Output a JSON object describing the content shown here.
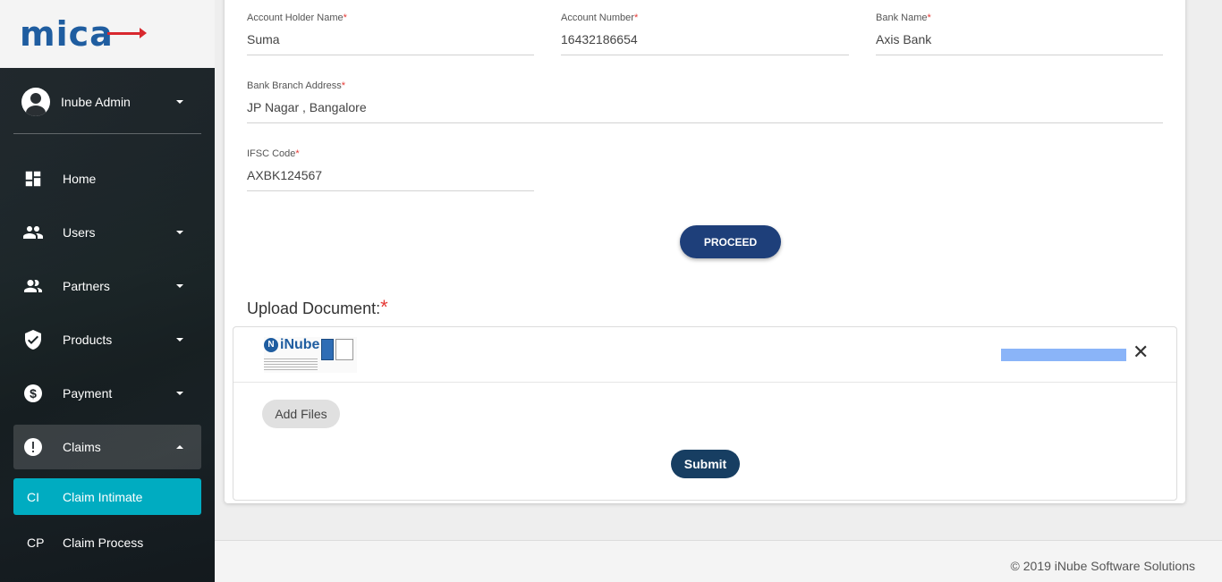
{
  "app": {
    "logo_text": "mica"
  },
  "user": {
    "name": "Inube Admin"
  },
  "sidebar": {
    "items": [
      {
        "label": "Home",
        "icon": "dashboard-icon"
      },
      {
        "label": "Users",
        "icon": "users-icon"
      },
      {
        "label": "Partners",
        "icon": "partners-icon"
      },
      {
        "label": "Products",
        "icon": "shield-check-icon"
      },
      {
        "label": "Payment",
        "icon": "dollar-icon"
      },
      {
        "label": "Claims",
        "icon": "alert-icon"
      }
    ],
    "sub_items": [
      {
        "abbr": "CI",
        "label": "Claim Intimate"
      },
      {
        "abbr": "CP",
        "label": "Claim Process"
      }
    ]
  },
  "form": {
    "account_holder": {
      "label": "Account Holder Name",
      "value": "Suma"
    },
    "account_number": {
      "label": "Account Number",
      "value": "16432186654"
    },
    "bank_name": {
      "label": "Bank Name",
      "value": "Axis Bank"
    },
    "branch_address": {
      "label": "Bank Branch Address",
      "value": "JP Nagar , Bangalore"
    },
    "ifsc": {
      "label": "IFSC Code",
      "value": "AXBK124567"
    },
    "required_mark": "*",
    "proceed_label": "PROCEED"
  },
  "upload": {
    "title": "Upload Document:",
    "required_mark": "*",
    "file_thumb_text": "iNube",
    "progress": 1.0,
    "remove_label": "✕",
    "add_files_label": "Add Files",
    "submit_label": "Submit"
  },
  "colors": {
    "brand_blue": "#1f5da0",
    "brand_red": "#d8282e",
    "active_teal": "#00acc1",
    "proceed_navy": "#1e3f7a",
    "submit_navy": "#173e62",
    "progress_fill": "#8ab4f8"
  },
  "footer": {
    "text": "© 2019 iNube Software Solutions"
  }
}
